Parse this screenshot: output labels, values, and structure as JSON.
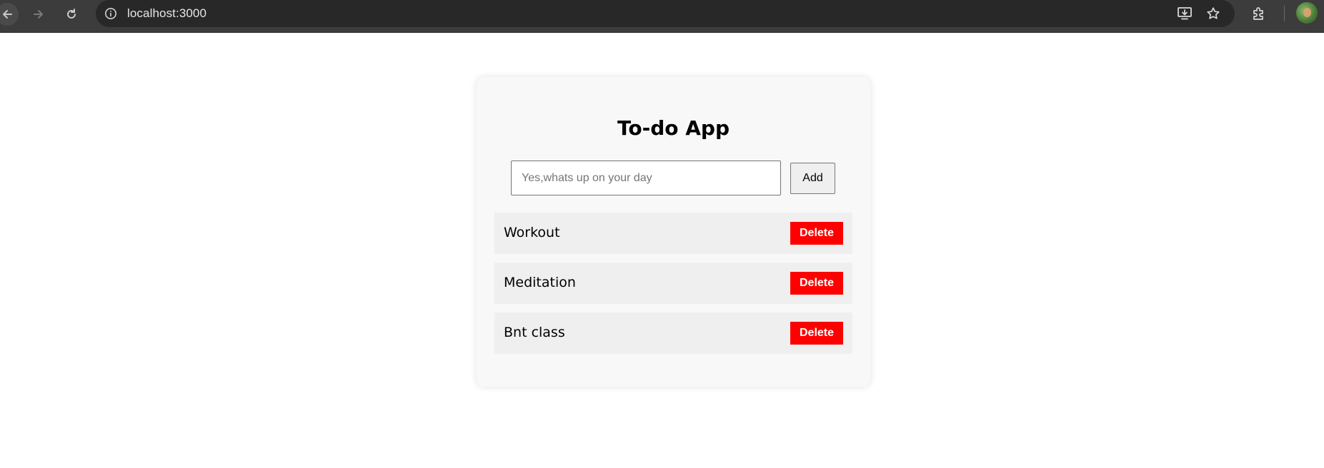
{
  "browser": {
    "url": "localhost:3000",
    "icons": [
      "back-icon",
      "forward-icon",
      "reload-icon",
      "info-icon",
      "install-icon",
      "star-icon",
      "extensions-icon",
      "avatar"
    ]
  },
  "app": {
    "title": "To-do App",
    "input": {
      "value": "",
      "placeholder": "Yes,whats up on your day"
    },
    "add_label": "Add",
    "todos": [
      {
        "text": "Workout",
        "delete_label": "Delete"
      },
      {
        "text": "Meditation",
        "delete_label": "Delete"
      },
      {
        "text": "Bnt class",
        "delete_label": "Delete"
      }
    ]
  },
  "colors": {
    "delete_button": "#ff0000",
    "card_background": "#f8f8f8",
    "item_background": "#efefef",
    "browser_chrome": "#3c3c3c"
  }
}
